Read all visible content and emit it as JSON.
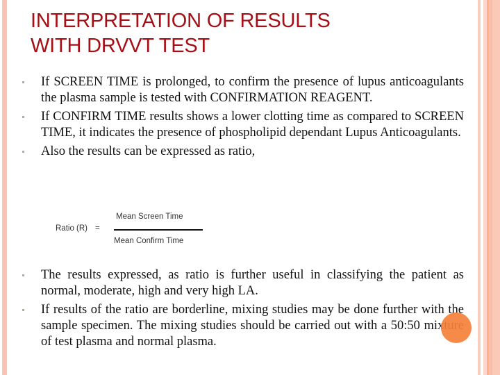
{
  "slide": {
    "title_line1": "INTERPRETATION OF RESULTS",
    "title_line2": "WITH DRVVT TEST",
    "bullets": [
      "If SCREEN TIME is prolonged, to confirm the presence of lupus anticoagulants the plasma sample is tested with CONFIRMATION REAGENT.",
      "If CONFIRM TIME results shows a lower clotting time as compared to SCREEN TIME, it indicates the presence of phospholipid dependant Lupus Anticoagulants.",
      "Also the results can be expressed as ratio,"
    ],
    "formula": {
      "lhs": "Ratio (R)",
      "equals": "=",
      "numerator": "Mean Screen Time",
      "denominator": "Mean Confirm Time"
    },
    "bullets_after": [
      "The results expressed, as ratio is further useful in classifying the patient as normal, moderate, high and very high LA.",
      "If results of the ratio are borderline, mixing studies may be done further with the sample specimen. The mixing studies should be carried out with a 50:50 mixture of test plasma and normal plasma."
    ]
  },
  "colors": {
    "title": "#a50f15",
    "border": "#f9c4b4",
    "pointer": "#f5803a"
  }
}
